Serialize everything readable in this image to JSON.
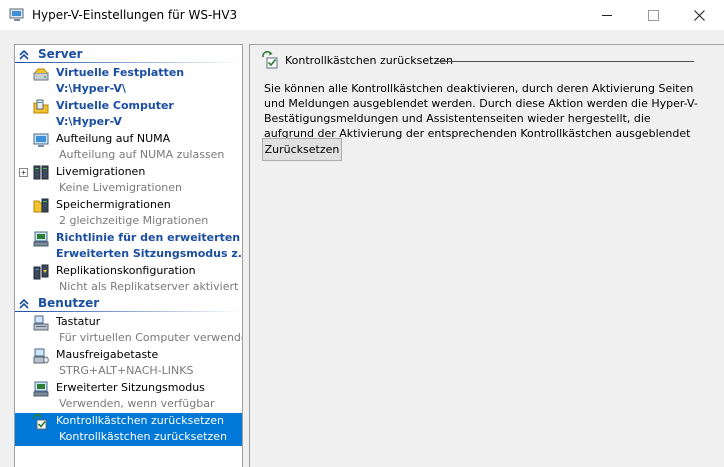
{
  "window": {
    "title": "Hyper-V-Einstellungen für WS-HV3",
    "minimize_label": "—",
    "close_label": "✕"
  },
  "sidebar": {
    "sections": [
      {
        "label": "Server"
      },
      {
        "label": "Benutzer"
      }
    ],
    "items": [
      {
        "name": "Virtuelle Festplatten",
        "sub": "V:\\Hyper-V\\",
        "icon": "hard-disk-icon"
      },
      {
        "name": "Virtuelle Computer",
        "sub": "V:\\Hyper-V",
        "icon": "virtual-computer-icon"
      },
      {
        "name": "Aufteilung auf NUMA",
        "sub": "Aufteilung auf NUMA zulassen",
        "icon": "numa-monitor-icon"
      },
      {
        "name": "Livemigrationen",
        "sub": "Keine Livemigrationen",
        "icon": "live-migration-icon",
        "expander": "+"
      },
      {
        "name": "Speichermigrationen",
        "sub": "2 gleichzeitige Migrationen",
        "icon": "storage-migration-icon"
      },
      {
        "name": "Richtlinie für den erweiterten ...",
        "sub": "Erweiterten Sitzungsmodus z...",
        "icon": "enhanced-session-policy-icon"
      },
      {
        "name": "Replikationskonfiguration",
        "sub": "Nicht als Replikatserver aktiviert",
        "icon": "replication-icon"
      },
      {
        "name": "Tastatur",
        "sub": "Für virtuellen Computer verwenden",
        "icon": "keyboard-icon"
      },
      {
        "name": "Mausfreigabetaste",
        "sub": "STRG+ALT+NACH-LINKS",
        "icon": "mouse-release-key-icon"
      },
      {
        "name": "Erweiterter Sitzungsmodus",
        "sub": "Verwenden, wenn verfügbar",
        "icon": "enhanced-session-icon"
      },
      {
        "name": "Kontrollkästchen zurücksetzen",
        "sub": "Kontrollkästchen zurücksetzen",
        "icon": "reset-checkboxes-icon"
      }
    ]
  },
  "main": {
    "group_title": "Kontrollkästchen zurücksetzen",
    "description": "Sie können alle Kontrollkästchen deaktivieren, durch deren Aktivierung Seiten und Meldungen ausgeblendet werden. Durch diese Aktion werden die Hyper-V-Bestätigungsmeldungen und Assistentenseiten wieder hergestellt, die aufgrund der Aktivierung der entsprechenden Kontrollkästchen ausgeblendet waren.",
    "reset_button": "Zurücksetzen"
  },
  "colors": {
    "accent_blue": "#1a4ea1",
    "selection": "#0078d7"
  }
}
